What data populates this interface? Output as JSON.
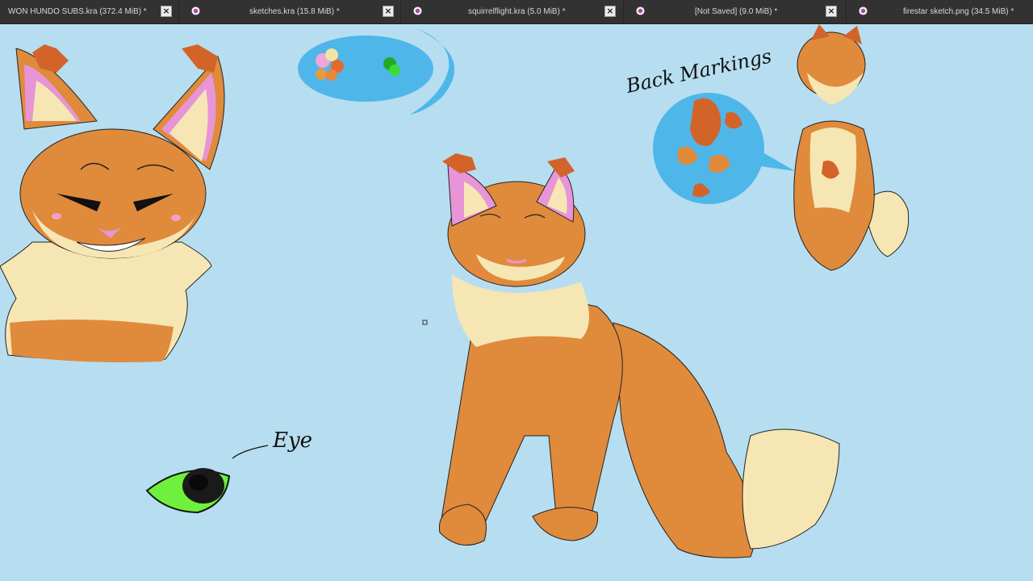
{
  "tabs": [
    {
      "label": "WON HUNDO SUBS.kra (372.4 MiB) *",
      "icon": "krita-icon",
      "close": "×"
    },
    {
      "label": "sketches.kra (15.8 MiB) *",
      "icon": "krita-icon",
      "close": "×"
    },
    {
      "label": "squirrelflight.kra (5.0 MiB) *",
      "icon": "krita-icon",
      "close": "×"
    },
    {
      "label": "[Not Saved] (9.0 MiB) *",
      "icon": "krita-icon",
      "close": "×"
    },
    {
      "label": "firestar sketch.png (34.5 MiB) *",
      "icon": "krita-icon"
    }
  ],
  "canvas": {
    "background": "#b6def0",
    "annotations": {
      "back_markings": "Back Markings",
      "eye": "Eye"
    },
    "palette_colors": [
      "#f0a7d8",
      "#f3e3a6",
      "#e36a2a",
      "#e89a3d",
      "#3acb3a",
      "#22aa22"
    ],
    "fur_colors": {
      "main": "#e08a3c",
      "dark": "#d2642a",
      "cream": "#f6e6b4",
      "ear_pink": "#e795d6",
      "eye_green": "#6ef03c"
    }
  }
}
